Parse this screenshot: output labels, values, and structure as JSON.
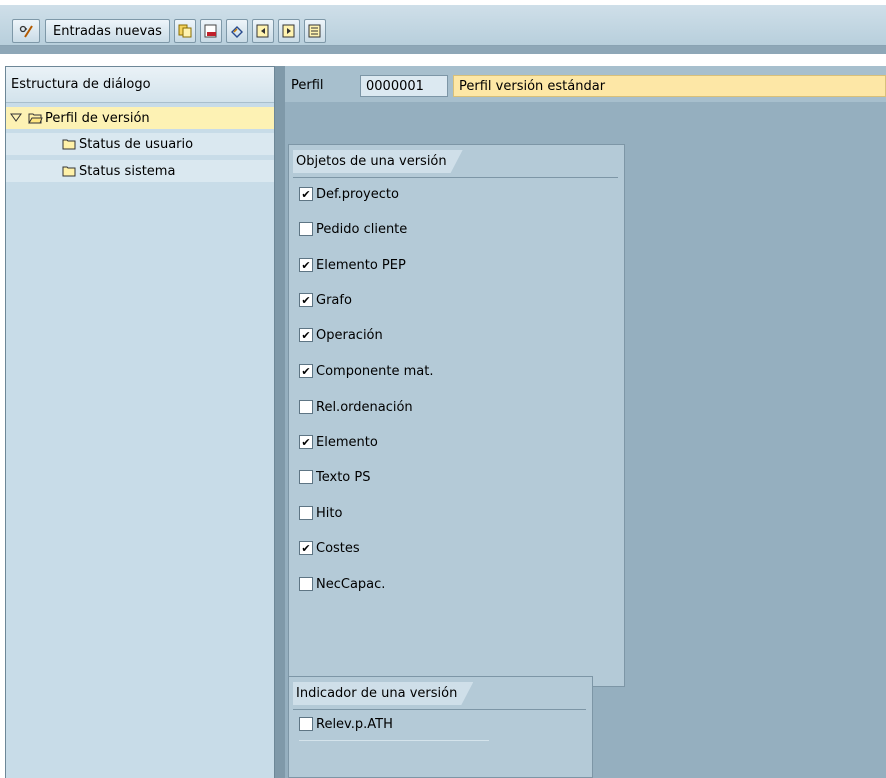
{
  "toolbar": {
    "new_entries_label": "Entradas nuevas",
    "icons": [
      "glasses-pencil-icon",
      "copy-icon",
      "delete-icon",
      "undo-icon",
      "previous-entry-icon",
      "next-entry-icon",
      "other-entry-icon"
    ]
  },
  "left_panel": {
    "header": "Estructura de diálogo",
    "tree": {
      "root_label": "Perfil de versión",
      "children": [
        "Status de usuario",
        "Status sistema"
      ]
    }
  },
  "profile": {
    "label": "Perfil",
    "id": "0000001",
    "description": "Perfil versión estándar"
  },
  "objects_group": {
    "title": "Objetos de una versión",
    "items": [
      {
        "label": "Def.proyecto",
        "checked": true
      },
      {
        "label": "Pedido cliente",
        "checked": false
      },
      {
        "label": "Elemento PEP",
        "checked": true
      },
      {
        "label": "Grafo",
        "checked": true
      },
      {
        "label": "Operación",
        "checked": true
      },
      {
        "label": "Componente mat.",
        "checked": true
      },
      {
        "label": "Rel.ordenación",
        "checked": false
      },
      {
        "label": "Elemento",
        "checked": true
      },
      {
        "label": "Texto PS",
        "checked": false
      },
      {
        "label": "Hito",
        "checked": false
      },
      {
        "label": "Costes",
        "checked": true
      },
      {
        "label": "NecCapac.",
        "checked": false
      }
    ]
  },
  "indicator_group": {
    "title": "Indicador de una versión",
    "items": [
      {
        "label": "Relev.p.ATH",
        "checked": false
      }
    ]
  },
  "colors": {
    "selected_row": "#fdf2b4",
    "description_field": "#fde7a6",
    "panel_background": "#c8dce8",
    "work_area": "#95afbf"
  }
}
